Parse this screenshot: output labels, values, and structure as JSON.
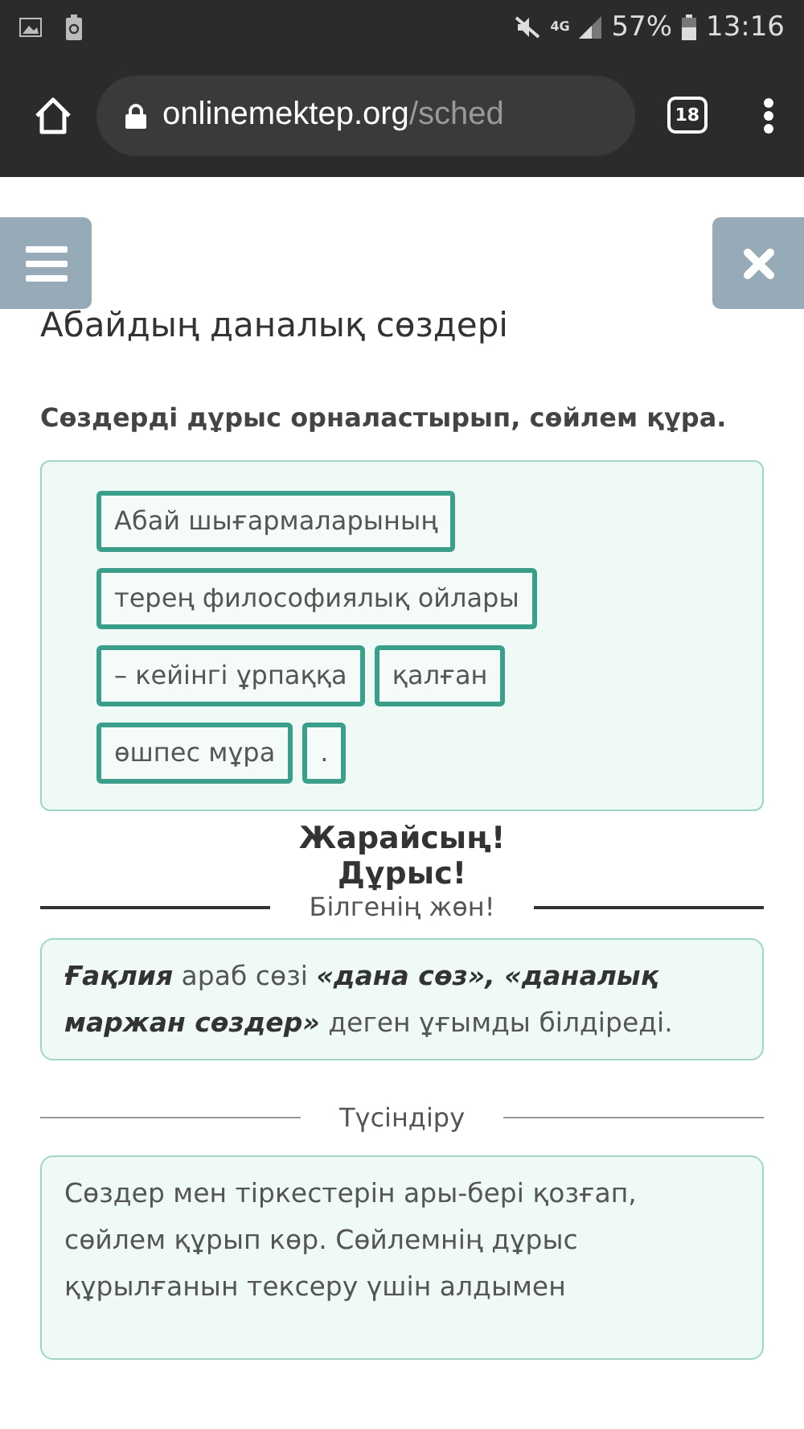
{
  "status_bar": {
    "network": "4G",
    "battery": "57%",
    "time": "13:16"
  },
  "browser": {
    "url_host": "onlinemektep.org",
    "url_path": "/sched",
    "tab_count": "18"
  },
  "page": {
    "title": "Абайдың даналық сөздері",
    "instruction": "Сөздерді дұрыс орналастырып, сөйлем құра.",
    "word_rows": [
      [
        "Абай шығармаларының"
      ],
      [
        "терең философиялық ойлары"
      ],
      [
        "– кейінгі ұрпаққа",
        "қалған"
      ],
      [
        "өшпес мұра",
        "."
      ]
    ],
    "feedback": [
      "Жарайсың!",
      "Дұрыс!"
    ],
    "info_divider": "Білгенің жөн!",
    "info_text": "**Ғақлия** араб сөзі **«дана сөз», «даналық маржан сөздер»** деген ұғымды білдіреді.",
    "explanation_divider": "Түсіндіру",
    "explanation_text": "Сөздер мен тіркестерін ары-бері қозғап, сөйлем құрып көр. Сөйлемнің дұрыс құрылғанын тексеру үшін алдымен"
  }
}
